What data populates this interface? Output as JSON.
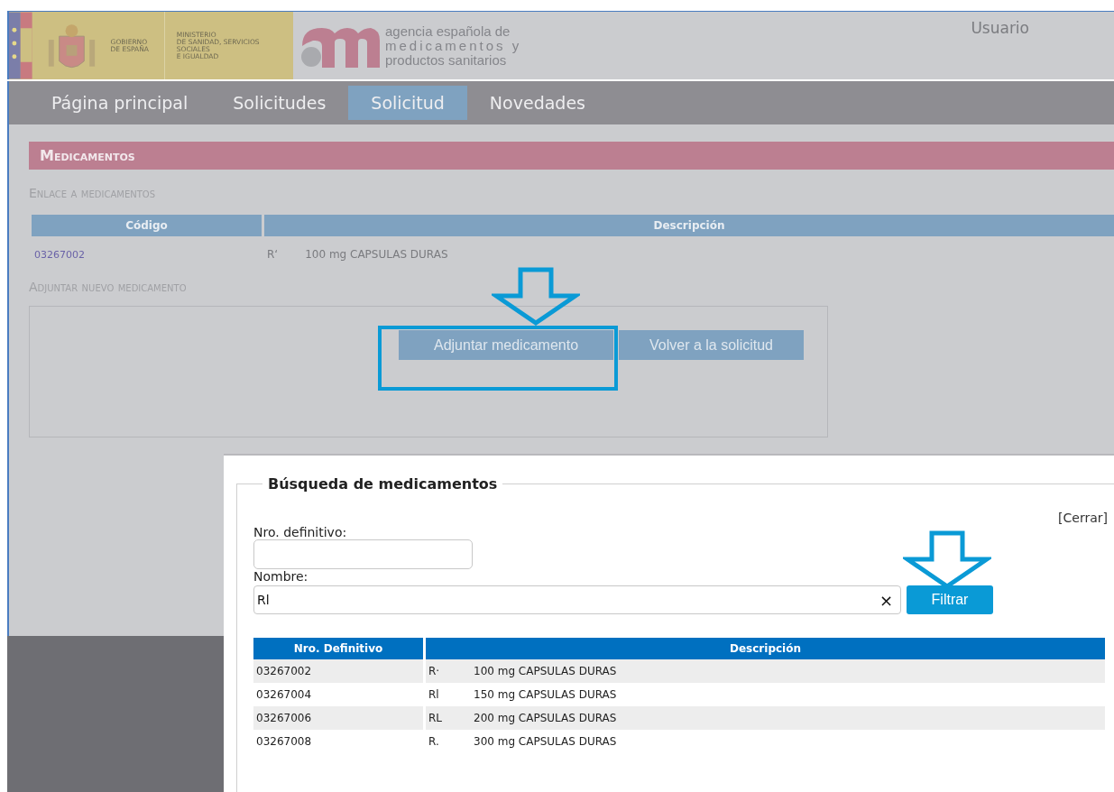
{
  "header": {
    "government": [
      "GOBIERNO",
      "DE ESPAÑA"
    ],
    "ministry": [
      "MINISTERIO",
      "DE SANIDAD, SERVICIOS SOCIALES",
      "E IGUALDAD"
    ],
    "agency": [
      "agencia española de",
      "medicamentos y",
      "productos sanitarios"
    ],
    "user": "Usuario"
  },
  "nav": [
    {
      "label": "Página principal",
      "selected": false
    },
    {
      "label": "Solicitudes",
      "selected": false
    },
    {
      "label": "Solicitud",
      "selected": true
    },
    {
      "label": "Novedades",
      "selected": false
    }
  ],
  "section": {
    "title": "Medicamentos",
    "linked_heading": "Enlace a medicamentos",
    "linked_table": {
      "columns": [
        "Código",
        "Descripción"
      ],
      "rows": [
        {
          "code": "03267002",
          "prefix": "R‘",
          "description": "100 mg CAPSULAS DURAS"
        }
      ]
    },
    "attach_heading": "Adjuntar nuevo medicamento",
    "buttons": [
      "Adjuntar medicamento",
      "Volver a la solicitud"
    ]
  },
  "modal": {
    "legend": "Búsqueda de medicamentos",
    "close": "[Cerrar]",
    "fields": [
      {
        "label": "Nro. definitivo:"
      },
      {
        "label": "Nombre:",
        "value": "Rl",
        "clear": "×"
      }
    ],
    "filter_button": "Filtrar",
    "table": {
      "columns": [
        "Nro. Definitivo",
        "Descripción"
      ],
      "rows": [
        {
          "number": "03267002",
          "prefix": "R·",
          "description": "100 mg CAPSULAS DURAS"
        },
        {
          "number": "03267004",
          "prefix": "Rl",
          "description": "150 mg CAPSULAS DURAS"
        },
        {
          "number": "03267006",
          "prefix": "RL",
          "description": "200 mg CAPSULAS DURAS"
        },
        {
          "number": "03267008",
          "prefix": "R.",
          "description": "300 mg CAPSULAS DURAS"
        }
      ]
    }
  }
}
